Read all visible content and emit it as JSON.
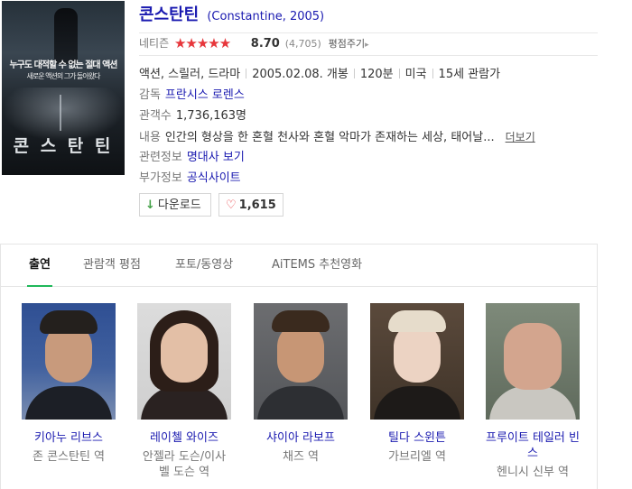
{
  "movie": {
    "title": "콘스탄틴",
    "subtitle": "(Constantine, 2005)",
    "poster": {
      "tagline_1": "누구도 대적할 수 없는 절대 액션",
      "tagline_2": "새로운 액션의 그가 돌아왔다",
      "title": "콘 스 탄 틴"
    }
  },
  "rating": {
    "label": "네티즌",
    "score_text": "8.70",
    "score_fraction": 0.87,
    "votes": "(4,705)",
    "rate_link": "평점주기",
    "rate_arrow": "▸",
    "stars_glyph": "★★★★★"
  },
  "info": {
    "genre": "액션, 스릴러, 드라마",
    "release": "2005.02.08. 개봉",
    "runtime": "120분",
    "country": "미국",
    "age": "15세 관람가",
    "director_label": "감독",
    "director": "프란시스 로렌스",
    "audience_label": "관객수",
    "audience": "1,736,163명",
    "plot_label": "내용",
    "plot": "인간의 형상을 한 혼혈 천사와 혼혈 악마가 존재하는 세상, 태어날...",
    "more": "더보기",
    "related_label": "관련정보",
    "related": "명대사 보기",
    "extra_label": "부가정보",
    "extra": "공식사이트"
  },
  "buttons": {
    "download": "다운로드",
    "download_icon": "↓",
    "likes": "1,615",
    "heart_icon": "♡"
  },
  "tabs": [
    "출연",
    "관람객 평점",
    "포토/동영상",
    "AiTEMS 추천영화"
  ],
  "cast": [
    {
      "name": "키아누 리브스",
      "role": "존 콘스탄틴 역"
    },
    {
      "name": "레이첼 와이즈",
      "role": "안젤라 도슨/이사벨 도슨 역"
    },
    {
      "name": "샤이아 라보프",
      "role": "채즈 역"
    },
    {
      "name": "틸다 스윈튼",
      "role": "가브리엘 역"
    },
    {
      "name": "프루이트 테일러 빈스",
      "role": "헨니시 신부 역"
    }
  ],
  "colors": {
    "accent_link": "#1a1ab0",
    "star": "#e8363b",
    "tab_underline": "#1fb85a"
  }
}
